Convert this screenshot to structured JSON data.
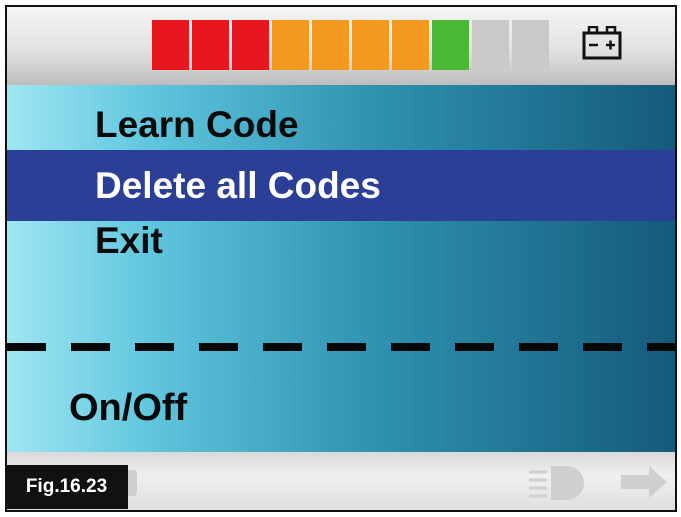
{
  "status": {
    "battery_segment_colors": [
      "#e8161e",
      "#e8161e",
      "#e8161e",
      "#f39a1f",
      "#f39a1f",
      "#f39a1f",
      "#f39a1f",
      "#49b833",
      "#c9c9c9",
      "#c9c9c9"
    ],
    "battery_icon": "battery-icon"
  },
  "menu": {
    "items": [
      {
        "label": "Learn Code",
        "selected": false
      },
      {
        "label": "Delete all Codes",
        "selected": true
      },
      {
        "label": "Exit",
        "selected": false
      }
    ],
    "highlight_color": "#2c3f96"
  },
  "footer": {
    "on_off_label": "On/Off"
  },
  "bottom_bar": {
    "icons": [
      "back-arrow-icon",
      "horn-icon",
      "light-icon",
      "forward-arrow-icon"
    ]
  },
  "figure_label": "Fig.16.23"
}
